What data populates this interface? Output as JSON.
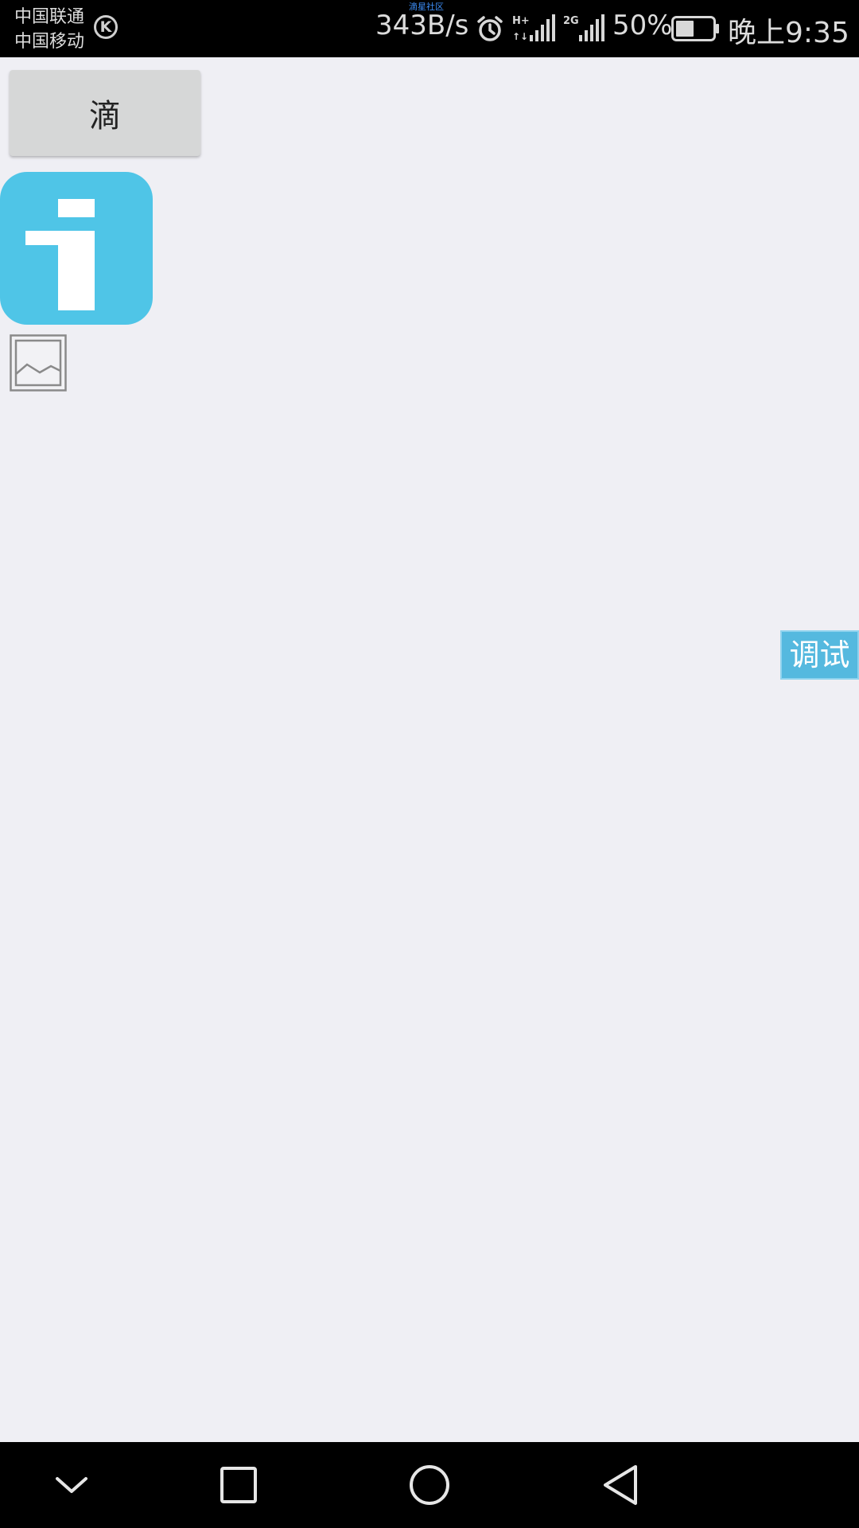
{
  "status_bar": {
    "carrier_1": "中国联通",
    "carrier_2": "中国移动",
    "carrier_icon": "k-circle-icon",
    "carrier_icon_text": "K",
    "notification_text": "滴星社区",
    "network_speed": "343B/s",
    "signal_1_label": "H+",
    "signal_2_label": "2G",
    "battery_percent": "50%",
    "battery_level": 0.5,
    "time": "晚上9:35"
  },
  "main": {
    "drip_button_label": "滴",
    "info_tile_icon": "info-i-icon",
    "image_placeholder_icon": "broken-image-icon",
    "debug_button_label": "调试"
  },
  "nav_bar": {
    "items": [
      {
        "icon": "chevron-down-icon"
      },
      {
        "icon": "square-recents-icon"
      },
      {
        "icon": "circle-home-icon"
      },
      {
        "icon": "triangle-back-icon"
      }
    ]
  },
  "colors": {
    "background": "#efeff4",
    "accent_blue": "#4fc5e7",
    "debug_blue": "#55b9df",
    "button_gray": "#d6d7d7",
    "bar_black": "#000000"
  }
}
